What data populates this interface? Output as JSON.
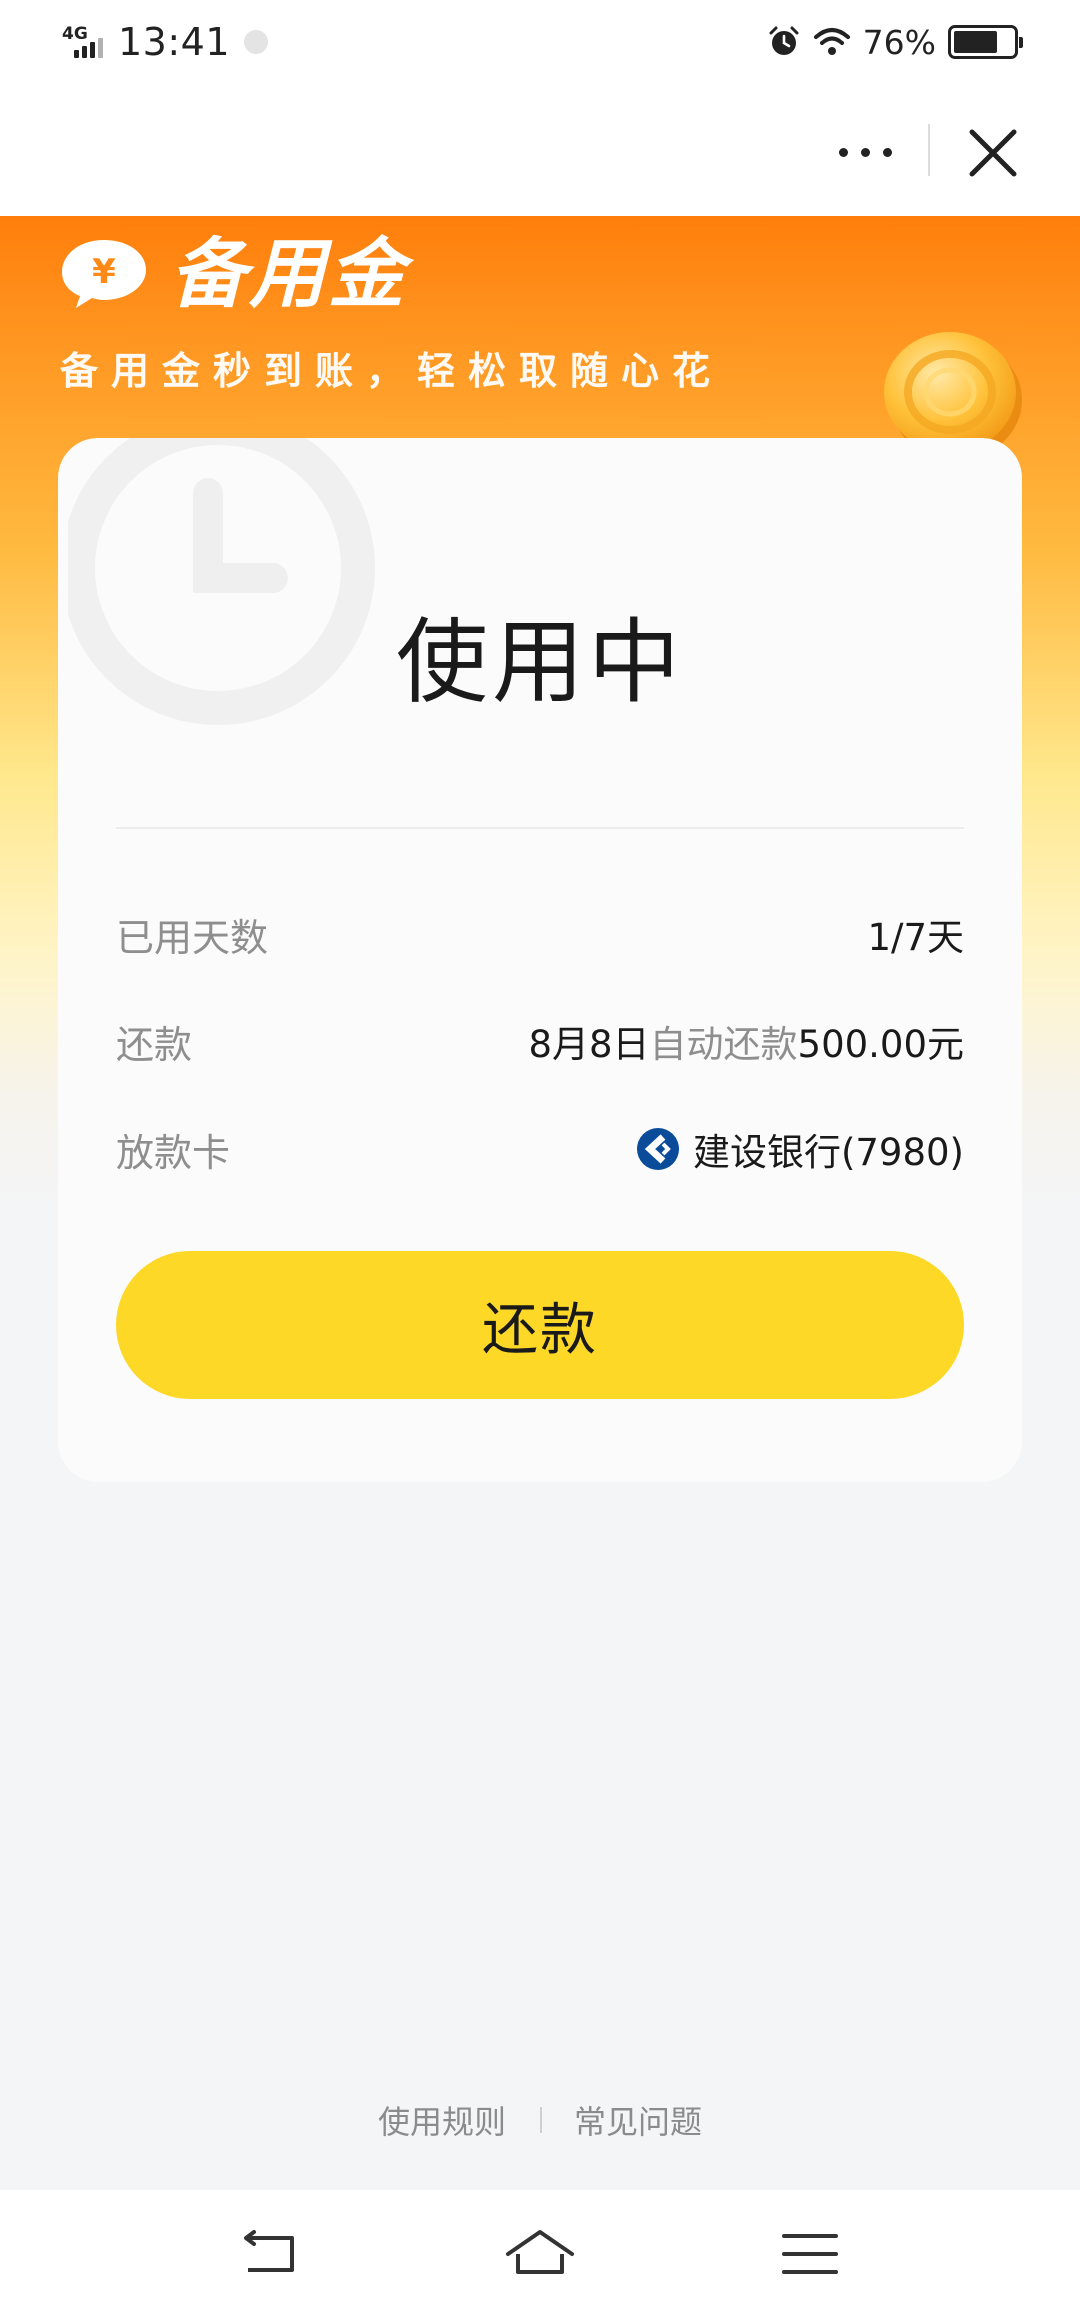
{
  "status_bar": {
    "network": "4G",
    "time": "13:41",
    "battery_percent_text": "76%",
    "battery_level": 0.76,
    "icons": [
      "signal-icon",
      "notification-dot-icon",
      "alarm-icon",
      "wifi-icon",
      "battery-icon"
    ]
  },
  "nav_bar": {
    "more_icon": "more-dots-icon",
    "close_icon": "close-icon"
  },
  "hero": {
    "logo_icon": "yen-badge-icon",
    "logo_symbol": "¥",
    "title": "备用金",
    "slogan": "备用金秒到账，轻松取随心花",
    "decoration_icon": "gold-coin-icon"
  },
  "card": {
    "status_title": "使用中",
    "watermark_icon": "clock-watermark-icon",
    "rows": [
      {
        "label": "已用天数",
        "value": "1/7天"
      },
      {
        "label": "还款",
        "value_date": "8月8日",
        "value_mid": "自动还款",
        "value_amount": "500.00元"
      },
      {
        "label": "放款卡",
        "bank_icon": "ccb-bank-icon",
        "value": "建设银行(7980)"
      }
    ],
    "repay_button": "还款"
  },
  "footer": {
    "links": [
      "使用规则",
      "常见问题"
    ]
  },
  "system_nav": {
    "icons": [
      "back-icon",
      "home-icon",
      "menu-icon"
    ]
  },
  "colors": {
    "hero_orange": "#ff7e0b",
    "hero_yellow": "#ffe88d",
    "button_yellow": "#fdd826",
    "page_background": "#f4f5f7",
    "bank_blue": "#0a4c9a"
  }
}
